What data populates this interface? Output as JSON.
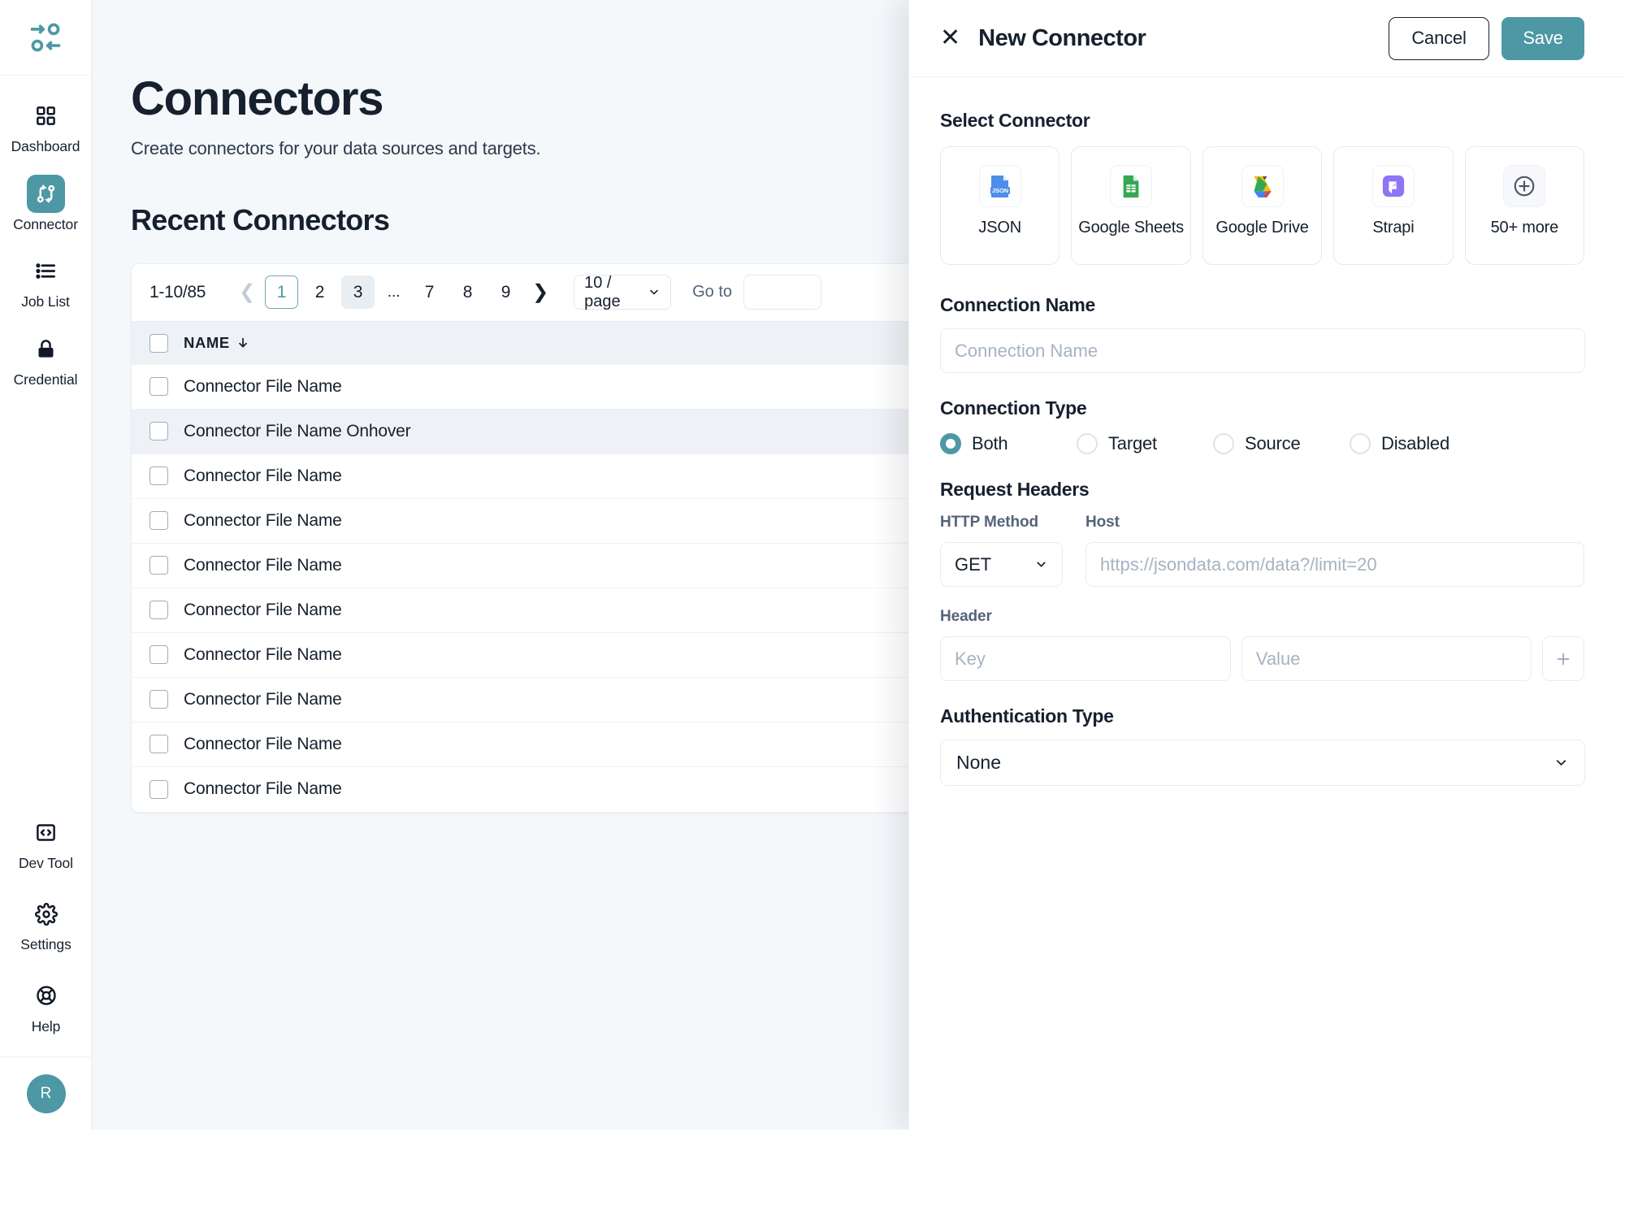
{
  "sidebar": {
    "logo_name": "swap-arrows-logo",
    "items": [
      {
        "label": "Dashboard",
        "icon": "grid-icon",
        "active": false
      },
      {
        "label": "Connector",
        "icon": "connector-icon",
        "active": true
      },
      {
        "label": "Job List",
        "icon": "list-icon",
        "active": false
      },
      {
        "label": "Credential",
        "icon": "lock-icon",
        "active": false
      }
    ],
    "bottom_items": [
      {
        "label": "Dev Tool",
        "icon": "code-icon"
      },
      {
        "label": "Settings",
        "icon": "gear-icon"
      },
      {
        "label": "Help",
        "icon": "lifebuoy-icon"
      }
    ],
    "avatar_initial": "R"
  },
  "page": {
    "title": "Connectors",
    "subtitle": "Create connectors for your data sources and targets.",
    "section_title": "Recent Connectors"
  },
  "pagination": {
    "range": "1-10/85",
    "prev_icon": "chevron-left-icon",
    "next_icon": "chevron-right-icon",
    "pages": [
      "1",
      "2",
      "3",
      "...",
      "7",
      "8",
      "9"
    ],
    "current_page": "1",
    "hovered_page": "3",
    "page_size": "10 / page",
    "goto_label": "Go to",
    "goto_value": ""
  },
  "table": {
    "column_header": "NAME",
    "sort_icon": "arrow-down-icon",
    "rows": [
      {
        "name": "Connector File Name",
        "hovered": false
      },
      {
        "name": "Connector File Name Onhover",
        "hovered": true
      },
      {
        "name": "Connector File Name",
        "hovered": false
      },
      {
        "name": "Connector File Name",
        "hovered": false
      },
      {
        "name": "Connector File Name",
        "hovered": false
      },
      {
        "name": "Connector File Name",
        "hovered": false
      },
      {
        "name": "Connector File Name",
        "hovered": false
      },
      {
        "name": "Connector File Name",
        "hovered": false
      },
      {
        "name": "Connector File Name",
        "hovered": false
      },
      {
        "name": "Connector File Name",
        "hovered": false
      }
    ]
  },
  "panel": {
    "close_icon": "close-x-icon",
    "title": "New Connector",
    "cancel_label": "Cancel",
    "save_label": "Save",
    "select_connector_label": "Select Connector",
    "connectors": [
      {
        "label": "JSON",
        "icon": "json-file-icon"
      },
      {
        "label": "Google Sheets",
        "icon": "google-sheets-icon"
      },
      {
        "label": "Google Drive",
        "icon": "google-drive-icon"
      },
      {
        "label": "Strapi",
        "icon": "strapi-icon"
      },
      {
        "label": "50+ more",
        "icon": "plus-circle-icon"
      }
    ],
    "connection_name_label": "Connection Name",
    "connection_name_placeholder": "Connection Name",
    "connection_name_value": "",
    "connection_type_label": "Connection Type",
    "connection_types": [
      {
        "label": "Both",
        "selected": true
      },
      {
        "label": "Target",
        "selected": false
      },
      {
        "label": "Source",
        "selected": false
      },
      {
        "label": "Disabled",
        "selected": false
      }
    ],
    "request_headers_label": "Request Headers",
    "http_method_label": "HTTP Method",
    "http_method_value": "GET",
    "host_label": "Host",
    "host_placeholder": "https://jsondata.com/data?/limit=20",
    "host_value": "",
    "header_label": "Header",
    "header_key_placeholder": "Key",
    "header_value_placeholder": "Value",
    "add_header_icon": "plus-icon",
    "auth_type_label": "Authentication Type",
    "auth_type_value": "None",
    "chevron_icon": "chevron-down-icon"
  },
  "colors": {
    "accent": "#4e98a5",
    "text": "#16202e",
    "muted": "#55637a",
    "bg": "#f4f8fb",
    "header_row": "#eef2f6"
  }
}
